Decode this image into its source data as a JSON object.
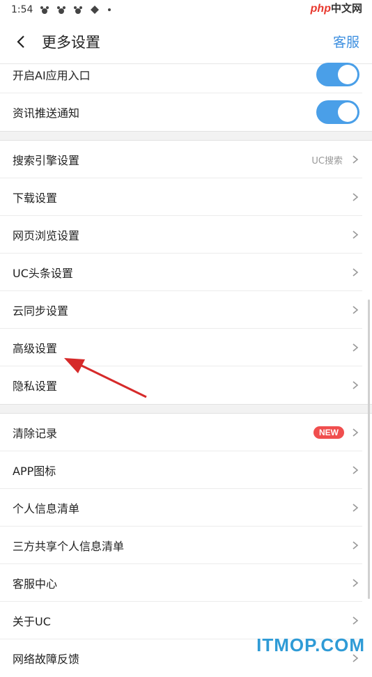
{
  "status_bar": {
    "time": "1:54"
  },
  "watermark_top": {
    "brand": "php",
    "suffix": "中文网"
  },
  "header": {
    "title": "更多设置",
    "service_label": "客服"
  },
  "toggles": [
    {
      "label": "开启AI应用入口",
      "on": true
    },
    {
      "label": "资讯推送通知",
      "on": true
    }
  ],
  "settings": [
    {
      "label": "搜索引擎设置",
      "value": "UC搜索"
    },
    {
      "label": "下载设置"
    },
    {
      "label": "网页浏览设置"
    },
    {
      "label": "UC头条设置"
    },
    {
      "label": "云同步设置"
    },
    {
      "label": "高级设置"
    },
    {
      "label": "隐私设置"
    }
  ],
  "more": [
    {
      "label": "清除记录",
      "badge": "NEW"
    },
    {
      "label": "APP图标"
    },
    {
      "label": "个人信息清单"
    },
    {
      "label": "三方共享个人信息清单"
    },
    {
      "label": "客服中心"
    },
    {
      "label": "关于UC"
    },
    {
      "label": "网络故障反馈"
    }
  ],
  "watermark_bottom": {
    "text": "ITMOP.COM"
  },
  "colors": {
    "accent": "#3d8fe0",
    "toggle": "#4a9fe8",
    "badge": "#f04e4e",
    "arrow": "#d62a2a"
  }
}
